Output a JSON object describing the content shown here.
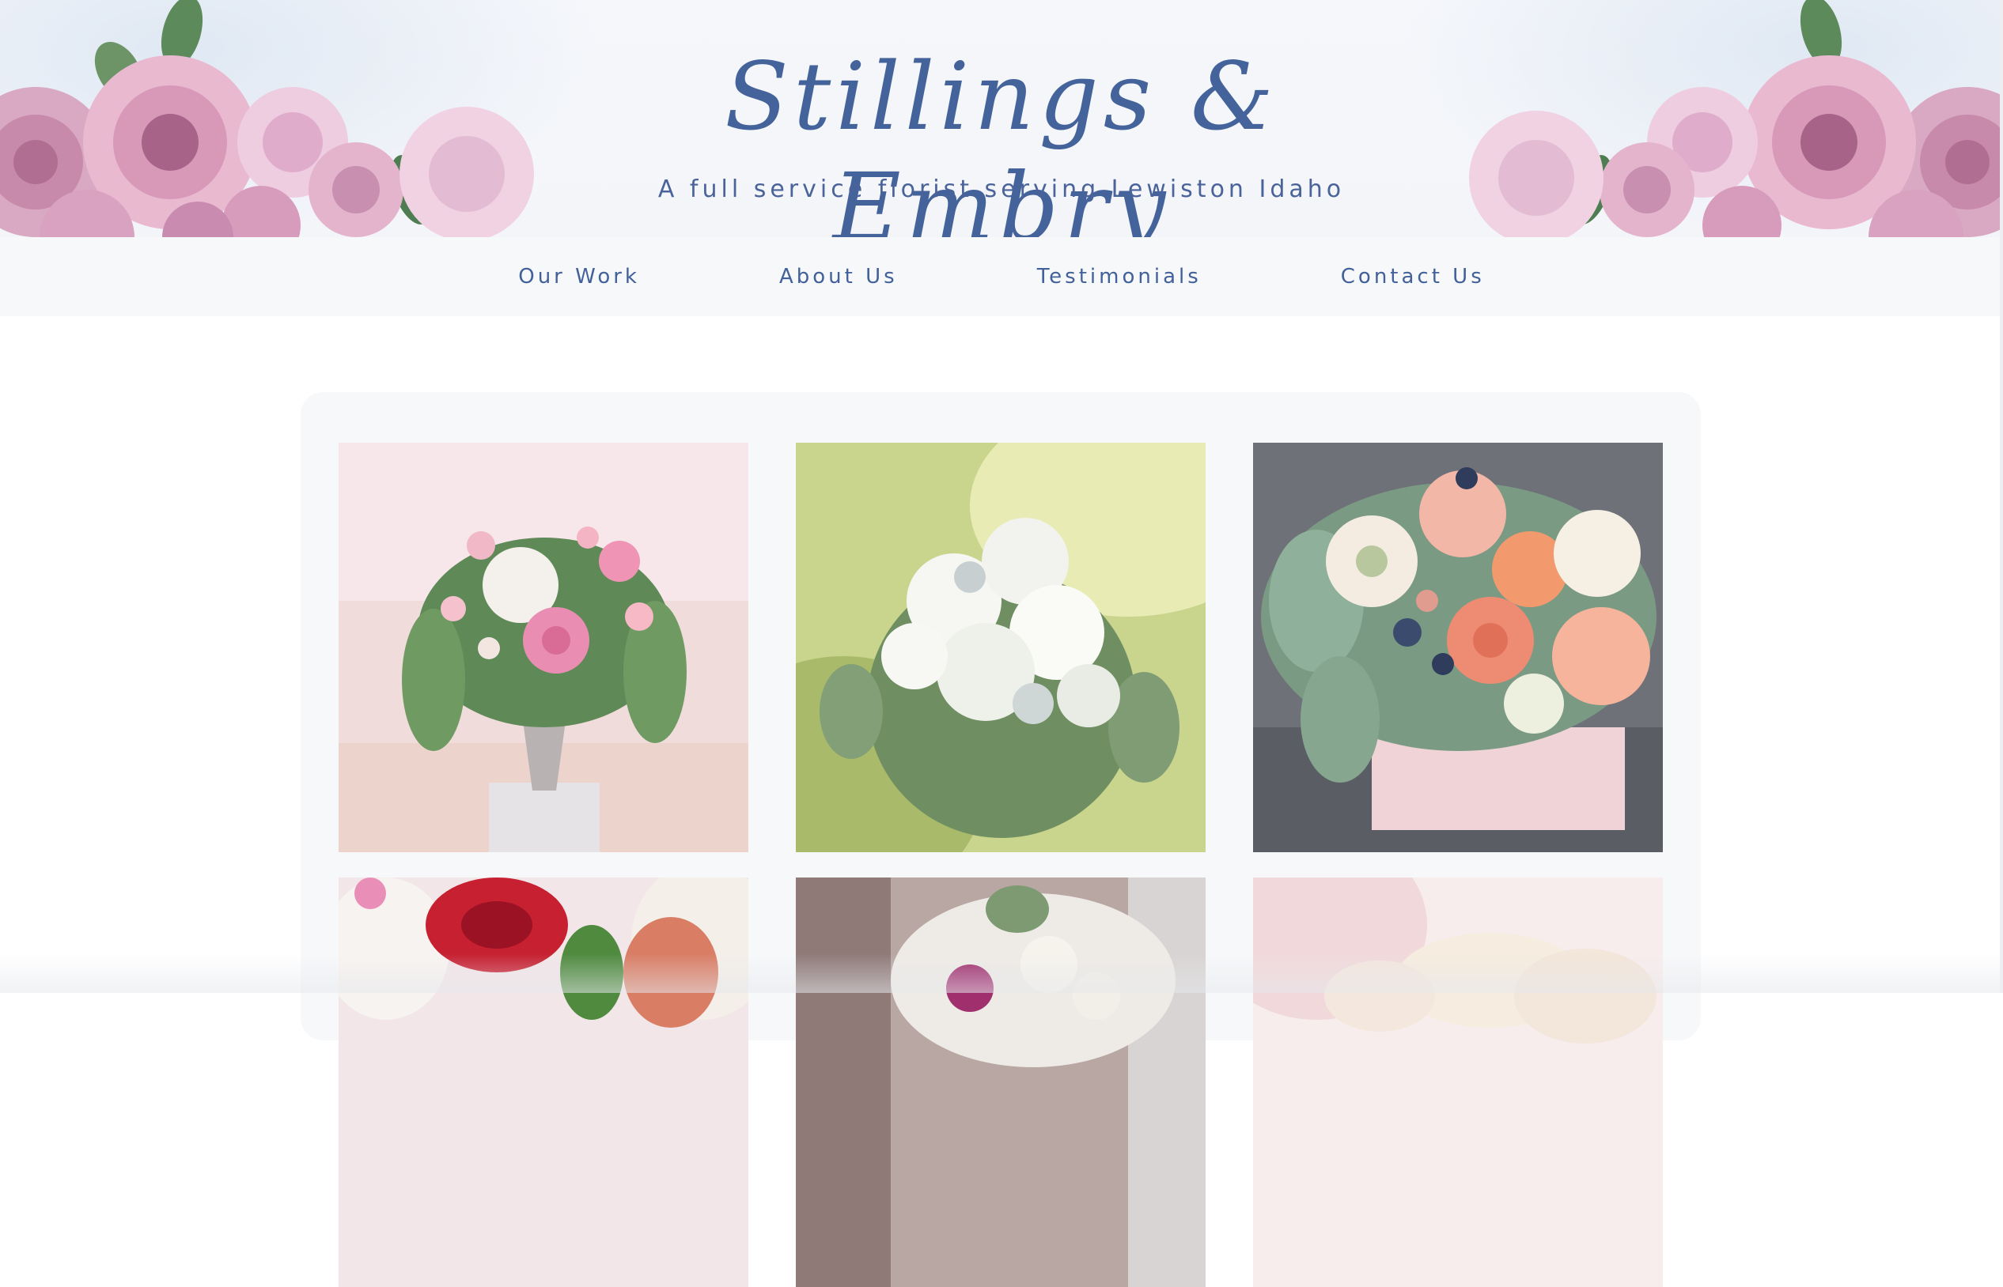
{
  "brand": {
    "title": "Stillings & Embry",
    "tagline": "A full service florist serving Lewiston Idaho"
  },
  "nav": {
    "items": [
      {
        "label": "Our Work"
      },
      {
        "label": "About Us"
      },
      {
        "label": "Testimonials"
      },
      {
        "label": "Contact Us"
      }
    ]
  },
  "colors": {
    "brand_blue": "#44639a",
    "nav_background": "#f6f8fa",
    "gallery_background": "#f6f8fa",
    "rose_pink": "#e7b6cc"
  },
  "gallery": {
    "photos": [
      {
        "subject": "pink-and-white-centerpiece-photo"
      },
      {
        "subject": "white-bouquet-photo"
      },
      {
        "subject": "peach-box-arrangement-photo"
      },
      {
        "subject": "red-rose-arrangement-photo"
      },
      {
        "subject": "bridal-bouquet-photo"
      },
      {
        "subject": "cream-roses-photo"
      }
    ]
  }
}
